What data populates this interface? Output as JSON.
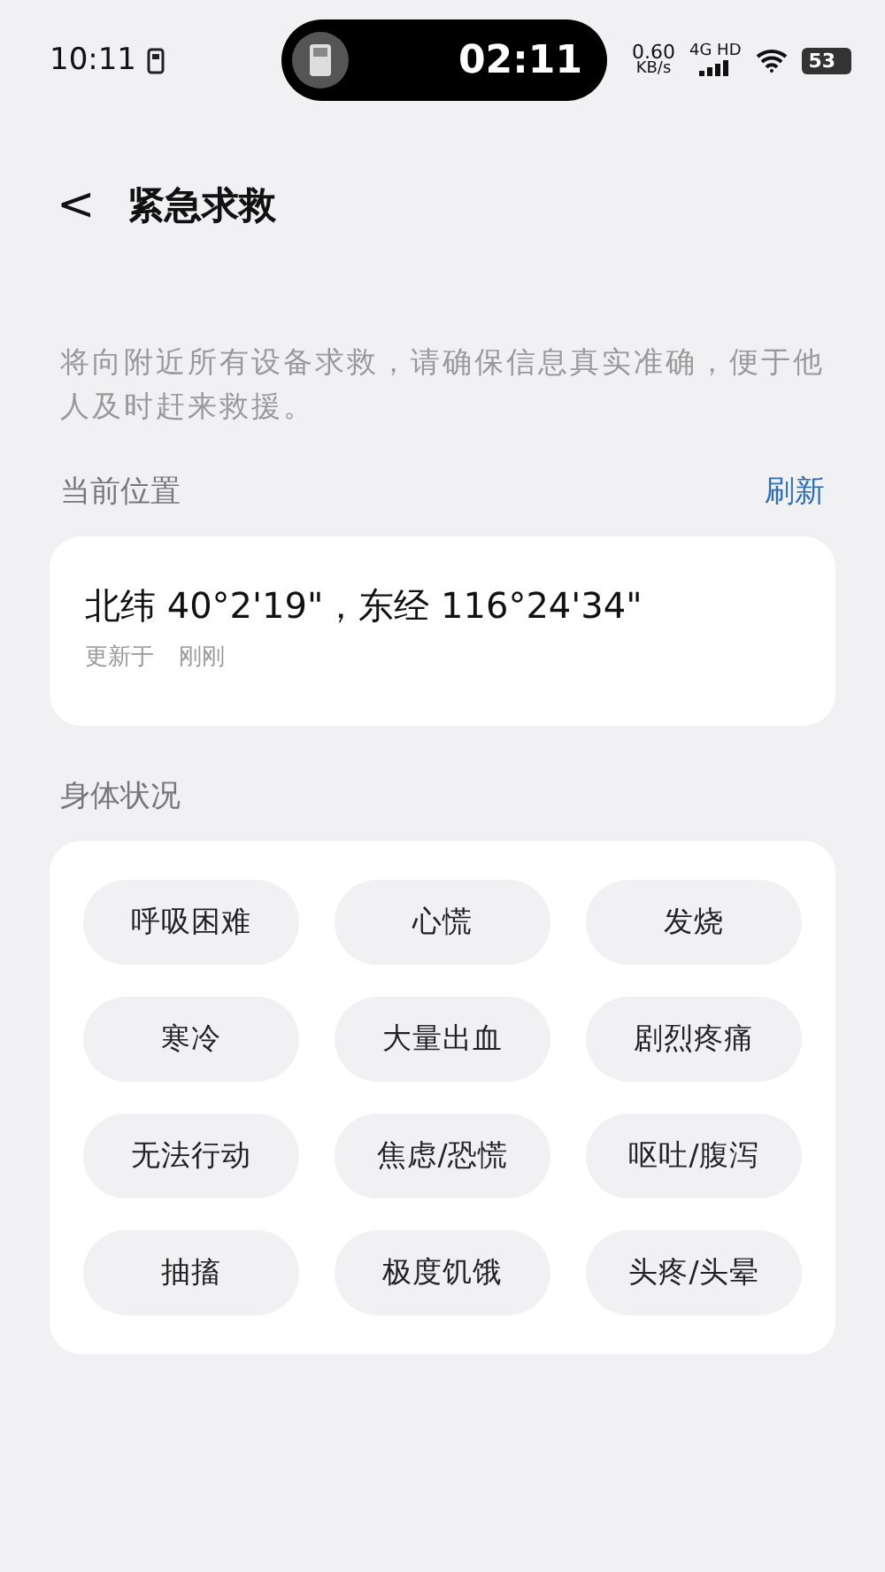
{
  "status_bar": {
    "time": "10:11",
    "island_time": "02:11",
    "speed": "0.60",
    "speed_unit": "KB/s",
    "network": "4G HD",
    "battery": "53"
  },
  "header": {
    "back": "<",
    "title": "紧急求救"
  },
  "description": "将向附近所有设备求救，请确保信息真实准确，便于他人及时赶来救援。",
  "location": {
    "label": "当前位置",
    "refresh": "刷新",
    "coordinates": "北纬 40°2'19\"，东经 116°24'34\"",
    "updated_label": "更新于",
    "updated_value": "刚刚"
  },
  "condition": {
    "label": "身体状况",
    "options": [
      {
        "label": "呼吸困难",
        "selected": false
      },
      {
        "label": "心慌",
        "selected": false
      },
      {
        "label": "发烧",
        "selected": false
      },
      {
        "label": "寒冷",
        "selected": false
      },
      {
        "label": "大量出血",
        "selected": false
      },
      {
        "label": "剧烈疼痛",
        "selected": false
      },
      {
        "label": "无法行动",
        "selected": false
      },
      {
        "label": "焦虑/恐慌",
        "selected": false
      },
      {
        "label": "呕吐/腹泻",
        "selected": false
      },
      {
        "label": "抽搐",
        "selected": false
      },
      {
        "label": "极度饥饿",
        "selected": false
      },
      {
        "label": "头疼/头晕",
        "selected": false
      }
    ]
  }
}
